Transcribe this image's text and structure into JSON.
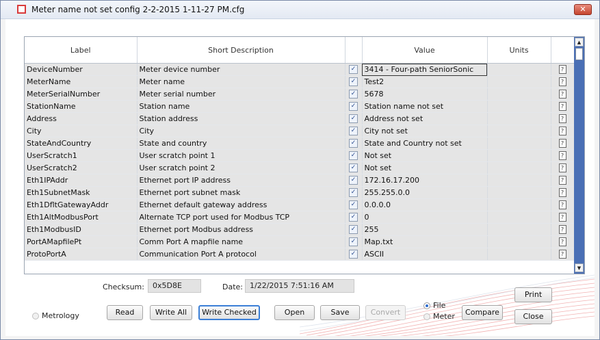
{
  "window": {
    "title": "Meter name not set config 2-2-2015 1-11-27 PM.cfg",
    "close_glyph": "✕"
  },
  "grid": {
    "headers": {
      "label": "Label",
      "short_description": "Short Description",
      "checked": "",
      "value": "Value",
      "units": "Units"
    },
    "rows": [
      {
        "label": "DeviceNumber",
        "desc": "Meter device number",
        "checked": true,
        "value": "3414 - Four-path SeniorSonic",
        "units": ""
      },
      {
        "label": "MeterName",
        "desc": "Meter name",
        "checked": true,
        "value": "Test2",
        "units": ""
      },
      {
        "label": "MeterSerialNumber",
        "desc": "Meter serial number",
        "checked": true,
        "value": "5678",
        "units": ""
      },
      {
        "label": "StationName",
        "desc": "Station name",
        "checked": true,
        "value": "Station name not set",
        "units": ""
      },
      {
        "label": "Address",
        "desc": "Station address",
        "checked": true,
        "value": "Address not set",
        "units": ""
      },
      {
        "label": "City",
        "desc": "City",
        "checked": true,
        "value": "City not set",
        "units": ""
      },
      {
        "label": "StateAndCountry",
        "desc": "State and country",
        "checked": true,
        "value": "State and Country not set",
        "units": ""
      },
      {
        "label": "UserScratch1",
        "desc": "User scratch point 1",
        "checked": true,
        "value": "Not set",
        "units": ""
      },
      {
        "label": "UserScratch2",
        "desc": "User scratch point 2",
        "checked": true,
        "value": "Not set",
        "units": ""
      },
      {
        "label": "Eth1IPAddr",
        "desc": "Ethernet port IP address",
        "checked": true,
        "value": "172.16.17.200",
        "units": ""
      },
      {
        "label": "Eth1SubnetMask",
        "desc": "Ethernet port subnet mask",
        "checked": true,
        "value": "255.255.0.0",
        "units": ""
      },
      {
        "label": "Eth1DfltGatewayAddr",
        "desc": "Ethernet default gateway address",
        "checked": true,
        "value": "0.0.0.0",
        "units": ""
      },
      {
        "label": "Eth1AltModbusPort",
        "desc": "Alternate TCP port used for Modbus TCP",
        "checked": true,
        "value": "0",
        "units": ""
      },
      {
        "label": "Eth1ModbusID",
        "desc": "Ethernet port Modbus address",
        "checked": true,
        "value": "255",
        "units": ""
      },
      {
        "label": "PortAMapfilePt",
        "desc": "Comm Port A mapfile name",
        "checked": true,
        "value": "Map.txt",
        "units": ""
      },
      {
        "label": "ProtoPortA",
        "desc": "Communication Port A protocol",
        "checked": true,
        "value": "ASCII",
        "units": ""
      }
    ],
    "check_glyph": "✓",
    "help_glyph": "?",
    "value_color": "#ffff00",
    "scroll_color": "#4a6fb5"
  },
  "footer": {
    "checksum_label": "Checksum:",
    "checksum_value": "0x5D8E",
    "date_label": "Date:",
    "date_value": "1/22/2015 7:51:16 AM",
    "metrology_label": "Metrology",
    "buttons": {
      "read": "Read",
      "write_all": "Write All",
      "write_checked": "Write Checked",
      "open": "Open",
      "save": "Save",
      "convert": "Convert",
      "compare": "Compare",
      "print": "Print",
      "close": "Close"
    },
    "source_options": {
      "file": "File",
      "meter": "Meter",
      "selected": "File"
    }
  }
}
